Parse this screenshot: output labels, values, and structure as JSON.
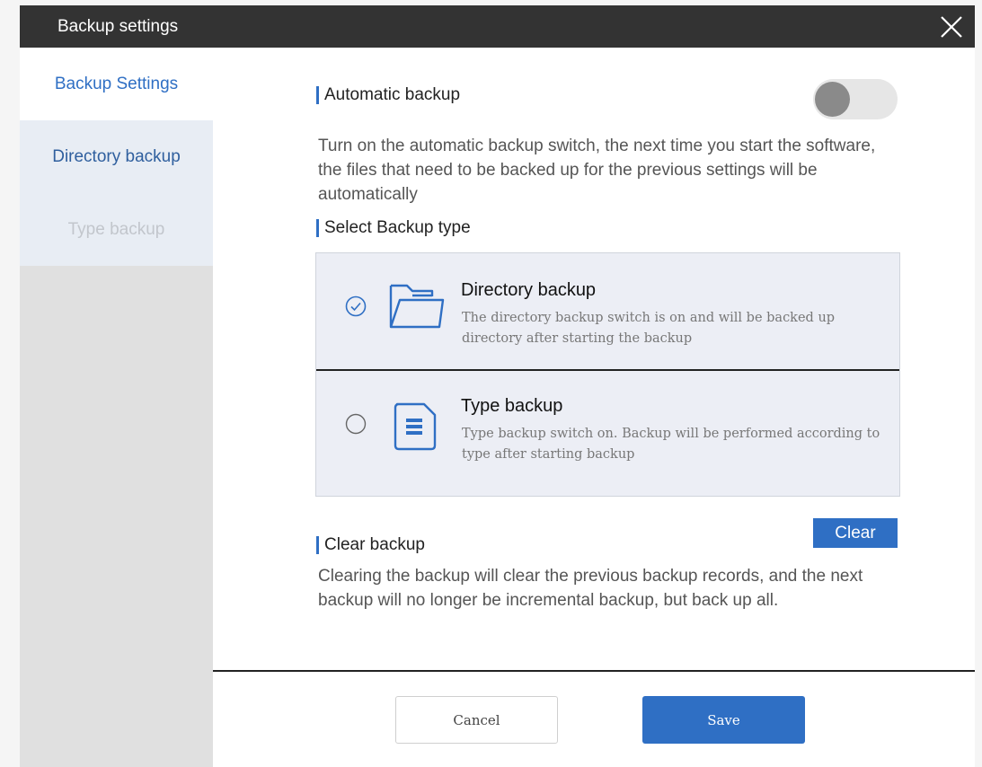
{
  "window": {
    "title": "Backup settings"
  },
  "sidebar": {
    "items": [
      {
        "label": "Backup Settings"
      },
      {
        "label": "Directory backup"
      },
      {
        "label": "Type backup"
      }
    ]
  },
  "auto_backup": {
    "heading": "Automatic backup",
    "enabled": false,
    "description": "Turn on the automatic backup switch, the next time you start the software, the files that need to be backed up for the previous settings will be automatically"
  },
  "backup_type": {
    "heading": "Select Backup type",
    "options": [
      {
        "name": "Directory backup",
        "description": "The directory backup switch is on and will be backed up directory after starting the backup",
        "selected": true
      },
      {
        "name": "Type backup",
        "description": "Type backup switch on. Backup will be performed according to type after starting backup",
        "selected": false
      }
    ]
  },
  "clear_backup": {
    "heading": "Clear backup",
    "button_label": "Clear",
    "description": "Clearing the backup will clear the previous backup records, and the next backup will no longer be incremental backup, but back up all."
  },
  "footer": {
    "cancel_label": "Cancel",
    "save_label": "Save"
  },
  "colors": {
    "accent": "#2f6fc4",
    "titlebar": "#333333",
    "sidebar": "#e0e0e0"
  }
}
